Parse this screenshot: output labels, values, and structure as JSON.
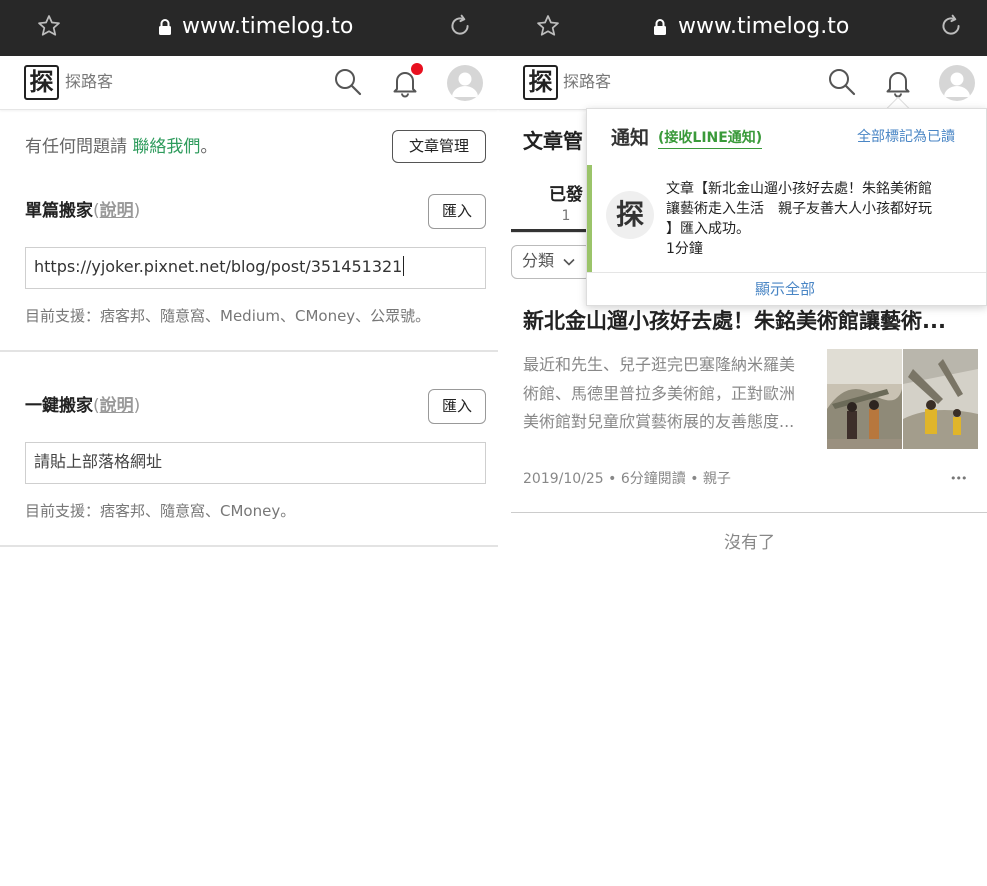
{
  "left": {
    "browser": {
      "url": "www.timelog.to"
    },
    "header": {
      "brand": "探路客",
      "logo_char": "探"
    },
    "contact": {
      "prefix": "有任何問題請",
      "link": "聯絡我們",
      "suffix": "。"
    },
    "manage_button": "文章管理",
    "single_move": {
      "title": "單篇搬家",
      "help_open": "(",
      "help_link": "說明",
      "help_close": ")",
      "import_button": "匯入",
      "input_value": "https://yjoker.pixnet.net/blog/post/351451321",
      "support": "目前支援：痞客邦、隨意窩、Medium、CMoney、公眾號。"
    },
    "one_click_move": {
      "title": "一鍵搬家",
      "help_open": "(",
      "help_link": "說明",
      "help_close": ")",
      "import_button": "匯入",
      "input_placeholder": "請貼上部落格網址",
      "support": "目前支援：痞客邦、隨意窩、CMoney。"
    }
  },
  "right": {
    "browser": {
      "url": "www.timelog.to"
    },
    "header": {
      "brand": "探路客",
      "logo_char": "探"
    },
    "page_title_partial": "文章管",
    "tab_partial": {
      "label": "已發",
      "count": "1"
    },
    "category_button": "分類",
    "notifications": {
      "title": "通知",
      "line_link": "(接收LINE通知)",
      "mark_all_read": "全部標記為已讀",
      "item": {
        "avatar_char": "探",
        "line1": "文章【新北金山遛小孩好去處！朱銘美術館",
        "line2": "讓藝術走入生活　親子友善大人小孩都好玩",
        "line3": "】匯入成功。",
        "time": "1分鐘"
      },
      "show_all": "顯示全部"
    },
    "article": {
      "title": "新北金山遛小孩好去處！朱銘美術館讓藝術...",
      "excerpt_lines": [
        "最近和先生、兒子逛完巴塞隆納米羅美",
        "術館、馬德里普拉多美術館，正對歐洲",
        "美術館對兒童欣賞藝術展的友善態度..."
      ],
      "meta": "2019/10/25 • 6分鐘閱讀 • 親子",
      "more": "•••"
    },
    "no_more": "沒有了"
  },
  "colors": {
    "browser_bar": "#282828",
    "link_green": "#2e9b5c",
    "line_link_green": "#3a9a3a",
    "blue_link": "#4a86c5",
    "notif_accent": "#9bc46a",
    "badge_red": "#e8101f"
  },
  "icons": {
    "star": "star-icon",
    "lock": "lock-icon",
    "reload": "reload-icon",
    "search": "search-icon",
    "bell": "bell-icon",
    "avatar": "user-avatar-icon",
    "chevron": "chevron-down-icon"
  }
}
